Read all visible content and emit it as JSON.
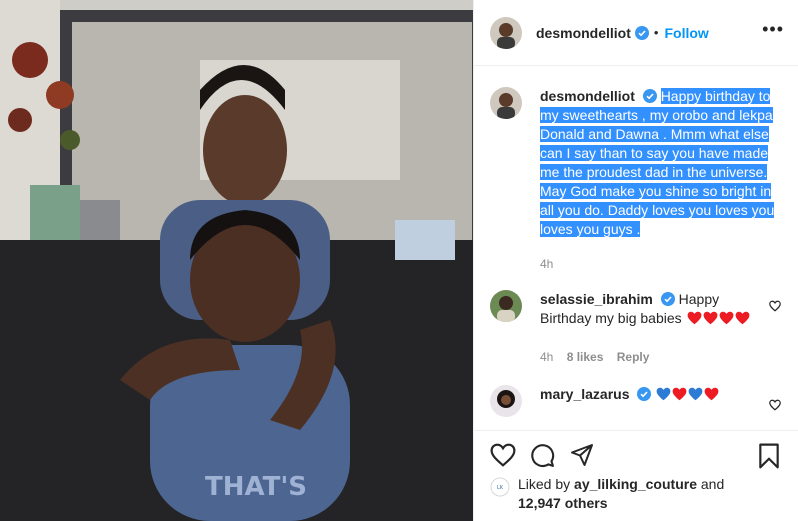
{
  "header": {
    "username": "desmondelliot",
    "separator": "•",
    "follow_label": "Follow",
    "more_label": "•••"
  },
  "caption": {
    "username": "desmondelliot",
    "lines": [
      "Happy birthday to",
      "my sweethearts , my orobo and lekpa",
      "Donald and Dawna . Mmm what else",
      "can I say than to say you have made",
      "me the proudest dad in the universe.",
      "May God make you shine so bright in",
      "all you do. Daddy loves you loves you",
      "loves you guys ."
    ],
    "time": "4h"
  },
  "comments": [
    {
      "username": "selassie_ibrahim",
      "text": "Happy Birthday my big babies",
      "hearts": [
        "red",
        "red",
        "red",
        "red"
      ],
      "time": "4h",
      "likes": "8 likes",
      "reply": "Reply"
    },
    {
      "username": "mary_lazarus",
      "text": "",
      "hearts": [
        "blue",
        "red",
        "blue",
        "red"
      ]
    }
  ],
  "likes": {
    "prefix": "Liked by",
    "user": "ay_lilking_couture",
    "and": "and",
    "others": "12,947 others"
  },
  "colors": {
    "accent": "#0095f6",
    "verified": "#3897f0",
    "selection": "#3390ff",
    "heart_red": "#ed1c24",
    "heart_blue": "#2e7bd6"
  },
  "icons": [
    "verified-badge-icon",
    "more-options-icon",
    "like-heart-icon",
    "comment-icon",
    "share-icon",
    "save-bookmark-icon"
  ]
}
